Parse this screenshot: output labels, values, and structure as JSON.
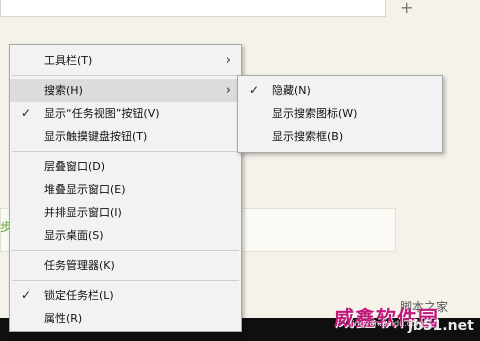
{
  "background": {
    "step_text": "步",
    "watermark_top": "脚本之家",
    "watermark_logo": "威鑫软件园",
    "watermark_small": "jingyan.baidu.com",
    "watermark_url": "jb51.net",
    "accent_color": "#c2187a"
  },
  "context_menu": {
    "items": [
      {
        "label": "工具栏(T)",
        "checked": false,
        "submenu": true
      },
      {
        "label": "搜索(H)",
        "checked": false,
        "submenu": true,
        "highlighted": true
      },
      {
        "label": "显示“任务视图”按钮(V)",
        "checked": true
      },
      {
        "label": "显示触摸键盘按钮(T)",
        "checked": false
      },
      {
        "label": "层叠窗口(D)"
      },
      {
        "label": "堆叠显示窗口(E)"
      },
      {
        "label": "并排显示窗口(I)"
      },
      {
        "label": "显示桌面(S)"
      },
      {
        "label": "任务管理器(K)"
      },
      {
        "label": "锁定任务栏(L)",
        "checked": true
      },
      {
        "label": "属性(R)"
      }
    ],
    "check_glyph": "✓",
    "arrow_glyph": "›"
  },
  "search_submenu": {
    "items": [
      {
        "label": "隐藏(N)",
        "checked": true
      },
      {
        "label": "显示搜索图标(W)",
        "checked": false
      },
      {
        "label": "显示搜索框(B)",
        "checked": false
      }
    ]
  }
}
